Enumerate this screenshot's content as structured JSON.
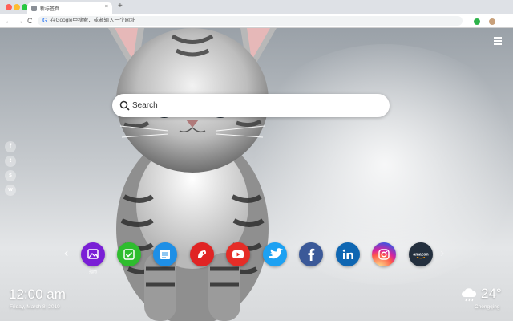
{
  "browser": {
    "tab_title": "新标签页",
    "tab_close": "×",
    "new_tab": "+",
    "nav_back": "←",
    "nav_forward": "→",
    "nav_reload": "C",
    "omnibox_icon": "G",
    "omnibox_placeholder": "在Google中搜索，或者输入一个网址",
    "menu_glyph": "⋮"
  },
  "search": {
    "placeholder": "Search"
  },
  "sidebar_social": [
    {
      "icon": "facebook-icon",
      "glyph": "f"
    },
    {
      "icon": "twitter-icon",
      "glyph": "t"
    },
    {
      "icon": "snapchat-icon",
      "glyph": "s"
    },
    {
      "icon": "wechat-icon",
      "glyph": "w"
    }
  ],
  "apps": {
    "prev": "‹",
    "next": "›",
    "first_label": "指南",
    "items": [
      {
        "icon": "wallpaper-icon",
        "color": "#7a1fd6"
      },
      {
        "icon": "todo-check-icon",
        "color": "#2ebd2e"
      },
      {
        "icon": "notes-icon",
        "color": "#1e8fe6"
      },
      {
        "icon": "game-icon",
        "color": "#e02424"
      },
      {
        "icon": "youtube-icon",
        "color": "#e52d27"
      },
      {
        "icon": "twitter-icon",
        "color": "#1da1f2"
      },
      {
        "icon": "facebook-icon",
        "color": "#3b5998"
      },
      {
        "icon": "linkedin-icon",
        "color": "#0e66b2"
      },
      {
        "icon": "instagram-icon",
        "color": "#c13584"
      },
      {
        "icon": "amazon-icon",
        "color": "#232f3e",
        "text": "amazon"
      }
    ]
  },
  "clock": {
    "time": "12:00 am",
    "date": "Friday, March 8, 2019"
  },
  "weather": {
    "icon": "cloud-rain-icon",
    "temperature": "24°",
    "city": "Chongqing"
  }
}
